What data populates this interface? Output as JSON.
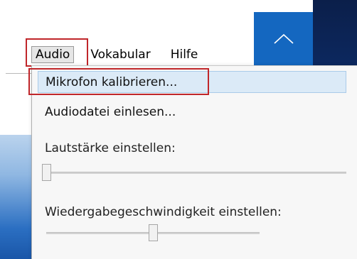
{
  "menubar": {
    "items": [
      {
        "label": "Audio",
        "active": true
      },
      {
        "label": "Vokabular",
        "active": false
      },
      {
        "label": "Hilfe",
        "active": false
      }
    ]
  },
  "collapse_button": {
    "icon": "chevron-up-icon"
  },
  "audio_menu": {
    "items": [
      {
        "label": "Mikrofon kalibrieren...",
        "highlighted": true
      },
      {
        "label": "Audiodatei einlesen...",
        "highlighted": false
      }
    ],
    "volume": {
      "label": "Lautstärke einstellen:",
      "value_fraction": 0.0
    },
    "playback_speed": {
      "label": "Wiedergabegeschwindigkeit einstellen:",
      "value_fraction": 0.5
    }
  },
  "colors": {
    "accent": "#1467c0",
    "highlight_box": "#c0262a",
    "menu_hover": "#dbeaf7"
  }
}
